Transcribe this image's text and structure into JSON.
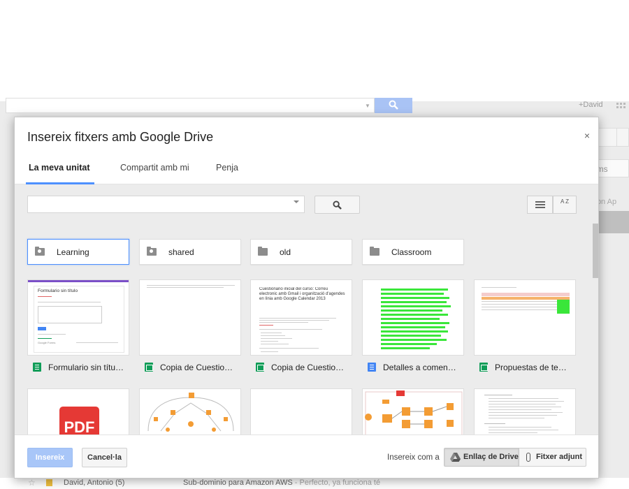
{
  "background": {
    "user": "+David",
    "right_label_1": "ums",
    "right_label_2": "icon Ap",
    "row": {
      "sender": "David, Antonio (5)",
      "subject": "Sub-dominio para Amazon AWS",
      "snippet": " - Perfecto, ya funciona té"
    }
  },
  "dialog": {
    "title": "Insereix fitxers amb Google Drive",
    "close": "×",
    "tabs": [
      {
        "label": "La meva unitat",
        "active": true
      },
      {
        "label": "Compartit amb mi",
        "active": false
      },
      {
        "label": "Penja",
        "active": false
      }
    ],
    "search": {
      "value": "",
      "placeholder": ""
    },
    "sort_label": "A Z",
    "folders": [
      {
        "name": "Learning",
        "icon": "shared-folder-icon",
        "selected": true
      },
      {
        "name": "shared",
        "icon": "shared-folder-icon",
        "selected": false
      },
      {
        "name": "old",
        "icon": "folder-icon",
        "selected": false
      },
      {
        "name": "Classroom",
        "icon": "folder-icon",
        "selected": false
      }
    ],
    "files": [
      {
        "title": "Formulario sin títu…",
        "type": "form"
      },
      {
        "title": "Copia de Cuestio…",
        "type": "sheet"
      },
      {
        "title": "Copia de Cuestio…",
        "type": "sheet"
      },
      {
        "title": "Detalles a comen…",
        "type": "doc"
      },
      {
        "title": "Propuestas de te…",
        "type": "sheet"
      }
    ],
    "file_row2": [
      {
        "kind": "pdf"
      },
      {
        "kind": "diagram"
      },
      {
        "kind": "blank"
      },
      {
        "kind": "aws-diagram"
      },
      {
        "kind": "doc-text"
      }
    ],
    "thumb_text": {
      "form_title": "Formulario sin título",
      "form_brand": "Google Forms",
      "quiz_title": "Cuestionario inicial del curso: Correu electronic amb Gmail i organització d'agendes en línia amb Google Calendar 2013",
      "pdf_label": "PDF"
    },
    "footer": {
      "insert": "Insereix",
      "cancel": "Cancel·la",
      "insert_as": "Insereix com a",
      "drive_link": "Enllaç de Drive",
      "attachment": "Fitxer adjunt"
    },
    "accent": "#4d90fe",
    "green": "#0f9d58"
  }
}
